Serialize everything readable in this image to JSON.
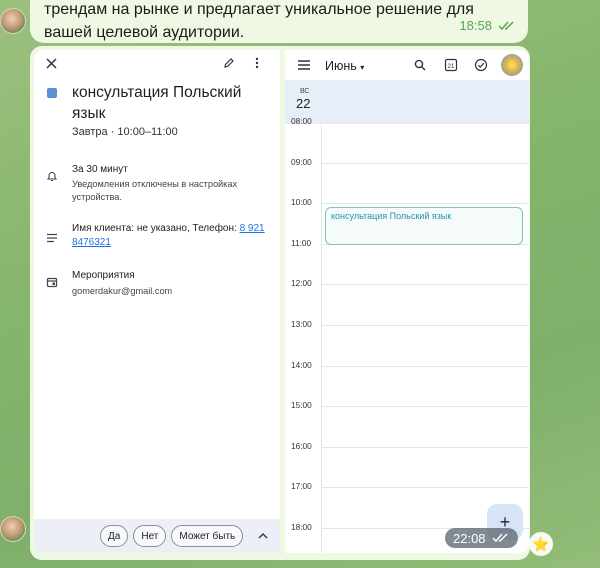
{
  "chat": {
    "message_text": "трендам на рынке и предлагает уникальное решение для вашей целевой аудитории.",
    "message_time": "18:58",
    "screenshot_time": "22:08",
    "reaction": "⭐"
  },
  "event": {
    "title": "консультация Польский язык",
    "when": "Завтра · 10:00–11:00",
    "reminder": "За 30 минут",
    "reminder_note": "Уведомления отключены в настройках устройства.",
    "description_prefix": "Имя клиента: не указано, Телефон: ",
    "phone": "8 921 8476321",
    "calendar_name": "Мероприятия",
    "calendar_email": "gomerdakur@gmail.com",
    "rsvp": {
      "yes": "Да",
      "no": "Нет",
      "maybe": "Может быть"
    }
  },
  "calendar": {
    "month": "Июнь",
    "day_name": "ВС",
    "day_number": "22",
    "hours": [
      "08:00",
      "09:00",
      "10:00",
      "11:00",
      "12:00",
      "13:00",
      "14:00",
      "15:00",
      "16:00",
      "17:00",
      "18:00"
    ],
    "event_label": "консультация Польский язык",
    "accent": "#5b8fd6"
  }
}
